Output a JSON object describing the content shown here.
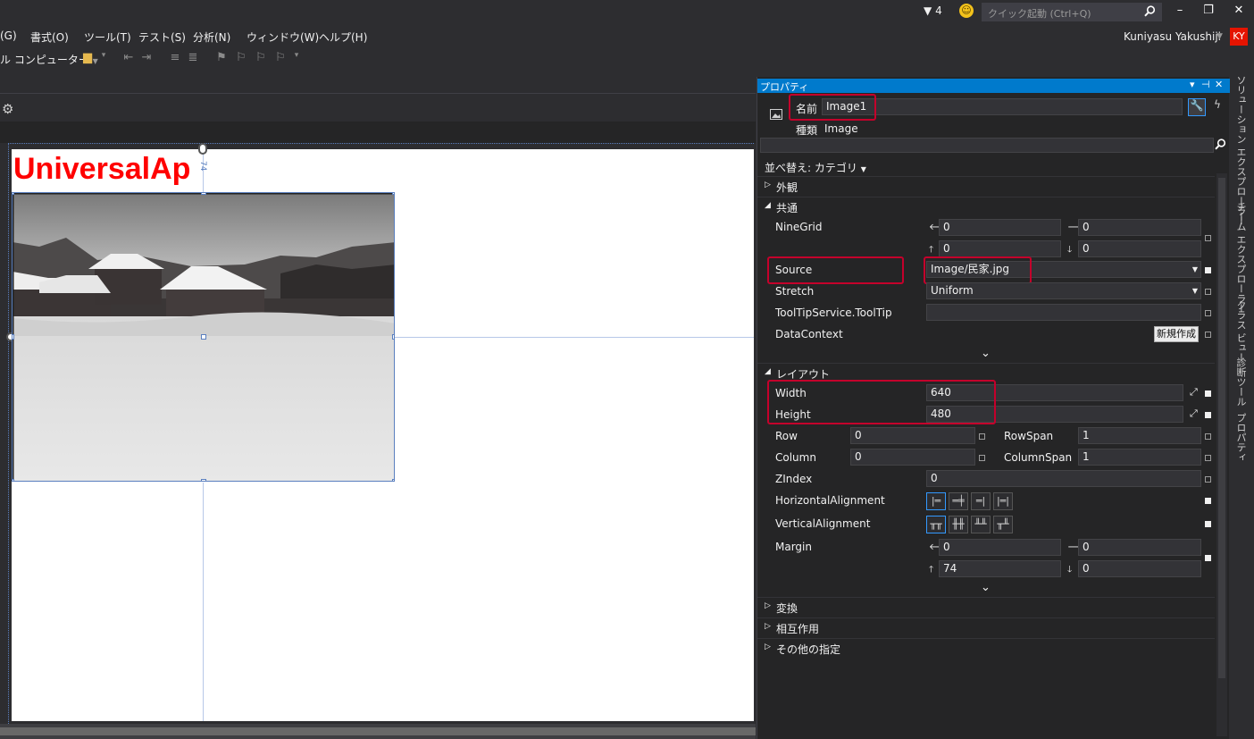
{
  "titlebar": {
    "notification_count": "4",
    "quick_launch_placeholder": "クイック起動 (Ctrl+Q)",
    "icons": [
      "filter-icon",
      "feedback-smiley-icon",
      "search-icon",
      "minimize-icon",
      "restore-icon",
      "close-icon"
    ]
  },
  "menu": {
    "items": [
      "(G)",
      "書式(O)",
      "ツール(T)",
      "テスト(S)",
      "分析(N)",
      "ウィンドウ(W)",
      "ヘルプ(H)"
    ],
    "user_name": "Kuniyasu Yakushiji",
    "user_initials": "KY"
  },
  "toolbar": {
    "target": "ル コンピューター"
  },
  "designer": {
    "app_title": "UniversalAp",
    "margin_label": "74"
  },
  "properties": {
    "title": "プロパティ",
    "name_label": "名前",
    "name_value": "Image1",
    "type_label": "種類",
    "type_value": "Image",
    "sort_label": "並べ替え: カテゴリ",
    "categories": {
      "appearance": "外観",
      "common": "共通",
      "layout": "レイアウト",
      "transform": "変換",
      "interactions": "相互作用",
      "misc": "その他の指定"
    },
    "common": {
      "ninegrid_label": "NineGrid",
      "ninegrid_values": [
        "0",
        "0",
        "0",
        "0"
      ],
      "source_label": "Source",
      "source_value": "Image/民家.jpg",
      "stretch_label": "Stretch",
      "stretch_value": "Uniform",
      "tooltip_label": "ToolTipService.ToolTip",
      "tooltip_value": "",
      "datacontext_label": "DataContext",
      "new_button": "新規作成"
    },
    "layout": {
      "width_label": "Width",
      "width_value": "640",
      "height_label": "Height",
      "height_value": "480",
      "row_label": "Row",
      "row_value": "0",
      "rowspan_label": "RowSpan",
      "rowspan_value": "1",
      "column_label": "Column",
      "column_value": "0",
      "columnspan_label": "ColumnSpan",
      "columnspan_value": "1",
      "zindex_label": "ZIndex",
      "zindex_value": "0",
      "halign_label": "HorizontalAlignment",
      "valign_label": "VerticalAlignment",
      "margin_label": "Margin",
      "margin_left": "0",
      "margin_right": "0",
      "margin_top": "74",
      "margin_bottom": "0"
    }
  },
  "side_tabs": [
    "ソリューション エクスプローラー",
    "チーム エクスプローラー",
    "クラス ビュー",
    "診断ツール",
    "プロパティ"
  ],
  "colors": {
    "accent": "#007acc",
    "highlight_box": "#c4002b",
    "app_title_red": "#ff0000",
    "user_badge": "#e51400"
  }
}
